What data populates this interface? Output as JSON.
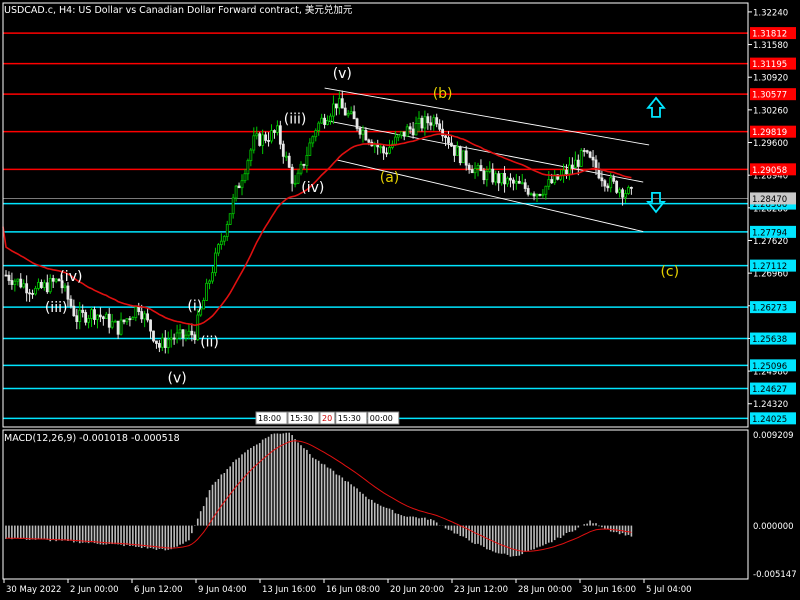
{
  "title": "USDCAD.c, H4:  US Dollar vs Canadian Dollar Forward contract, 美元兑加元",
  "macd": {
    "label": "MACD(12,26,9) -0.001018 -0.000518",
    "ticks": [
      "0.009209",
      "0.000000",
      "-0.005147"
    ]
  },
  "colors": {
    "background": "#000000",
    "candle_up": "#00C800",
    "candle_down": "#E8E8E8",
    "red_level": "#FF0000",
    "cyan_level": "#00E5FF",
    "moving_average": "#E01010",
    "channel": "#FFFFFF",
    "wave_white": "#FFFFFF",
    "wave_yellow": "#E6D200",
    "arrow": "#00E5FF"
  },
  "chart_data": [
    {
      "type": "candlestick",
      "title": "USDCAD.c, H4",
      "ylim": [
        1.2385,
        1.3242
      ],
      "price_ticks": [
        "1.32240",
        "1.31580",
        "1.30920",
        "1.30260",
        "1.29600",
        "1.28940",
        "1.28280",
        "1.27620",
        "1.26960",
        "1.26300",
        "1.25640",
        "1.24980",
        "1.24320",
        "1.23660"
      ],
      "time_ticks": [
        "30 May 2022",
        "2 Jun 00:00",
        "6 Jun 12:00",
        "9 Jun 04:00",
        "13 Jun 16:00",
        "16 Jun 08:00",
        "20 Jun 20:00",
        "23 Jun 12:00",
        "28 Jun 00:00",
        "30 Jun 16:00",
        "5 Jul 04:00"
      ],
      "red_levels": [
        "1.31812",
        "1.31195",
        "1.30577",
        "1.29819",
        "1.29058"
      ],
      "cyan_levels": [
        "1.28366",
        "1.27794",
        "1.27112",
        "1.26273",
        "1.25638",
        "1.25096",
        "1.24627",
        "1.24025"
      ],
      "current_price": "1.28470",
      "bars_count": 150,
      "anchors": [
        [
          0,
          1.2692
        ],
        [
          10,
          1.266
        ],
        [
          18,
          1.2682
        ],
        [
          24,
          1.2605
        ],
        [
          30,
          1.2617
        ],
        [
          38,
          1.2585
        ],
        [
          45,
          1.263
        ],
        [
          52,
          1.2548
        ],
        [
          56,
          1.2566
        ],
        [
          60,
          1.2567
        ],
        [
          64,
          1.2575
        ],
        [
          70,
          1.2705
        ],
        [
          78,
          1.286
        ],
        [
          84,
          1.2962
        ],
        [
          92,
          1.298
        ],
        [
          98,
          1.287
        ],
        [
          105,
          1.299
        ],
        [
          112,
          1.304
        ],
        [
          120,
          1.299
        ],
        [
          128,
          1.294
        ],
        [
          136,
          1.2985
        ],
        [
          146,
          1.301
        ],
        [
          152,
          1.2945
        ],
        [
          160,
          1.29
        ],
        [
          170,
          1.288
        ],
        [
          180,
          1.286
        ],
        [
          188,
          1.289
        ],
        [
          196,
          1.2935
        ],
        [
          204,
          1.288
        ],
        [
          212,
          1.2855
        ]
      ],
      "wave_labels": [
        {
          "text": "(v)",
          "bar": 114,
          "price": 1.309,
          "color": "white"
        },
        {
          "text": "(iii)",
          "bar": 98,
          "price": 1.2998,
          "color": "white"
        },
        {
          "text": "(iv)",
          "bar": 104,
          "price": 1.286,
          "color": "white"
        },
        {
          "text": "(b)",
          "bar": 148,
          "price": 1.305,
          "color": "yellow"
        },
        {
          "text": "(a)",
          "bar": 130,
          "price": 1.288,
          "color": "yellow"
        },
        {
          "text": "(iv)",
          "bar": 22,
          "price": 1.268,
          "color": "white"
        },
        {
          "text": "(iii)",
          "bar": 17,
          "price": 1.2617,
          "color": "white"
        },
        {
          "text": "(i)",
          "bar": 64,
          "price": 1.262,
          "color": "white"
        },
        {
          "text": "(ii)",
          "bar": 69,
          "price": 1.2548,
          "color": "white"
        },
        {
          "text": "(v)",
          "bar": 58,
          "price": 1.2475,
          "color": "white"
        },
        {
          "text": "(c)",
          "bar": 225,
          "price": 1.269,
          "color": "yellow"
        }
      ],
      "time_boxes": [
        "18:00",
        "15:30",
        "20",
        "15:30",
        "00:00"
      ]
    },
    {
      "type": "bar",
      "title": "MACD(12,26,9)",
      "ylim": [
        -0.005147,
        0.009209
      ],
      "anchors": [
        [
          0,
          -0.0012
        ],
        [
          20,
          -0.0015
        ],
        [
          40,
          -0.0019
        ],
        [
          55,
          -0.0024
        ],
        [
          62,
          -0.0014
        ],
        [
          70,
          0.004
        ],
        [
          80,
          0.0069
        ],
        [
          90,
          0.0088
        ],
        [
          96,
          0.009
        ],
        [
          104,
          0.0066
        ],
        [
          114,
          0.0046
        ],
        [
          124,
          0.0024
        ],
        [
          134,
          0.001
        ],
        [
          144,
          0.0006
        ],
        [
          154,
          -0.001
        ],
        [
          164,
          -0.0024
        ],
        [
          172,
          -0.003
        ],
        [
          182,
          -0.002
        ],
        [
          190,
          -0.0008
        ],
        [
          198,
          0.0004
        ],
        [
          206,
          -0.0006
        ],
        [
          212,
          -0.001
        ]
      ]
    }
  ]
}
